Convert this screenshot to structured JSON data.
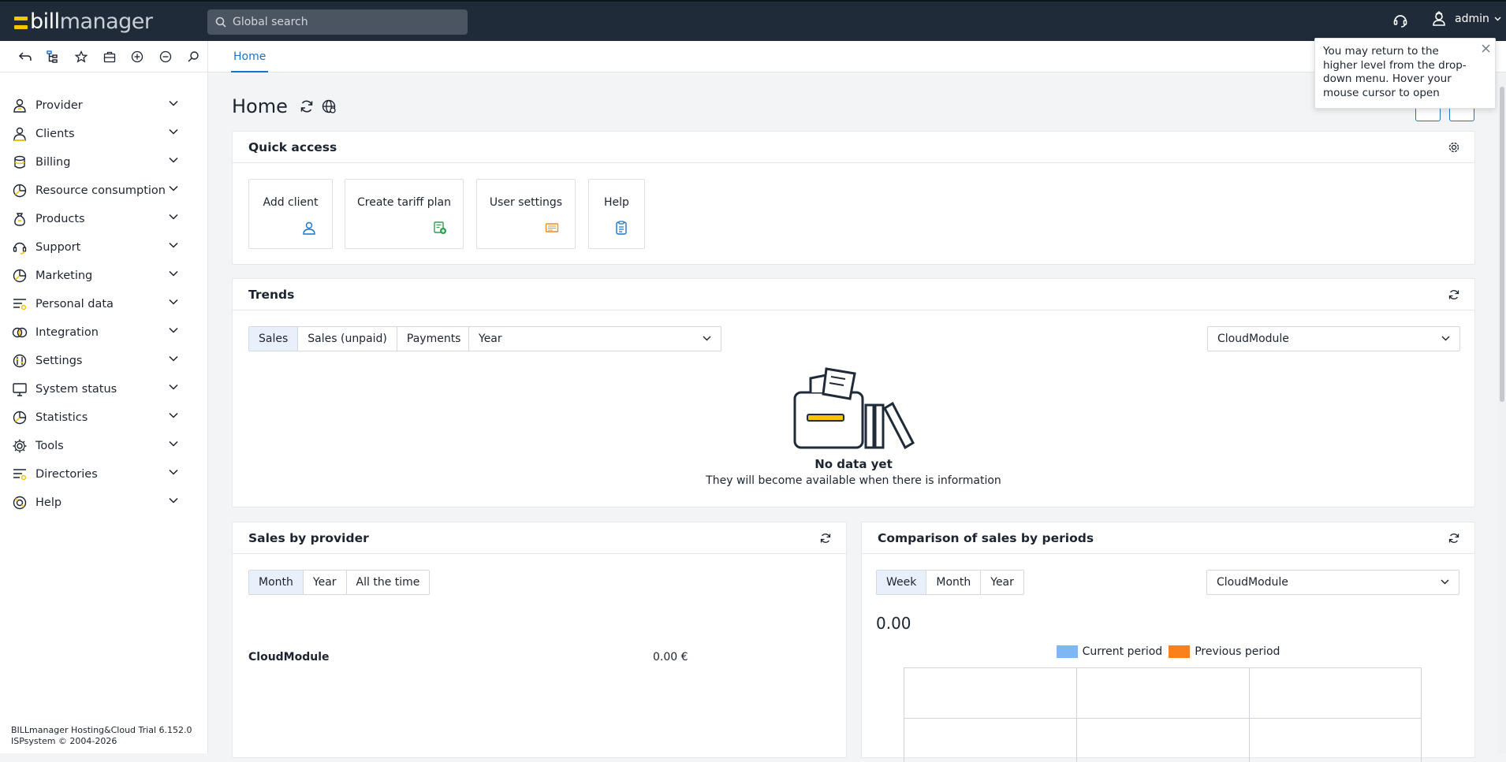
{
  "app": {
    "logo_text": "billmanager",
    "logo_bill": "bill",
    "logo_manager": "manager"
  },
  "topbar": {
    "search_placeholder": "Global search",
    "user_name": "admin"
  },
  "tabs": [
    {
      "label": "Home",
      "active": true
    }
  ],
  "sidebar": {
    "items": [
      {
        "label": "Provider",
        "icon": "provider-icon"
      },
      {
        "label": "Clients",
        "icon": "clients-icon"
      },
      {
        "label": "Billing",
        "icon": "billing-icon"
      },
      {
        "label": "Resource consumption",
        "icon": "pie-chart-icon"
      },
      {
        "label": "Products",
        "icon": "money-bag-icon"
      },
      {
        "label": "Support",
        "icon": "headset-icon"
      },
      {
        "label": "Marketing",
        "icon": "pie-chart-icon"
      },
      {
        "label": "Personal data",
        "icon": "list-icon"
      },
      {
        "label": "Integration",
        "icon": "rings-icon"
      },
      {
        "label": "Settings",
        "icon": "sliders-icon"
      },
      {
        "label": "System status",
        "icon": "monitor-icon"
      },
      {
        "label": "Statistics",
        "icon": "pie-chart-icon"
      },
      {
        "label": "Tools",
        "icon": "gear-icon"
      },
      {
        "label": "Directories",
        "icon": "list-icon"
      },
      {
        "label": "Help",
        "icon": "lifebuoy-icon"
      }
    ],
    "footer_line1": "BILLmanager Hosting&Cloud Trial 6.152.0",
    "footer_line2": "ISPsystem © 2004-2026"
  },
  "page": {
    "title": "Home"
  },
  "tooltip": {
    "text": "You may return to the higher level from the drop-down menu. Hover your mouse cursor to open"
  },
  "quick_access": {
    "title": "Quick access",
    "cards": [
      {
        "label": "Add client",
        "icon": "add-user-icon",
        "color": "#1a73c9"
      },
      {
        "label": "Create tariff plan",
        "icon": "tariff-plan-icon",
        "color": "#2aa44f"
      },
      {
        "label": "User settings",
        "icon": "user-settings-icon",
        "color": "#f08a24"
      },
      {
        "label": "Help",
        "icon": "help-doc-icon",
        "color": "#1a73c9"
      }
    ]
  },
  "trends": {
    "title": "Trends",
    "segments": [
      "Sales",
      "Sales (unpaid)",
      "Payments"
    ],
    "active_segment": "Sales",
    "period_select": "Year",
    "module_select": "CloudModule",
    "empty_title": "No data yet",
    "empty_subtitle": "They will become available when there is information"
  },
  "sales_by_provider": {
    "title": "Sales by provider",
    "segments": [
      "Month",
      "Year",
      "All the time"
    ],
    "active_segment": "Month",
    "rows": [
      {
        "name": "CloudModule",
        "value": "0.00 €"
      }
    ]
  },
  "comparison": {
    "title": "Comparison of sales by periods",
    "segments": [
      "Week",
      "Month",
      "Year"
    ],
    "active_segment": "Week",
    "module_select": "CloudModule",
    "total": "0.00",
    "legend": [
      {
        "label": "Current period",
        "color": "#7db7f5"
      },
      {
        "label": "Previous period",
        "color": "#f9801d"
      }
    ]
  },
  "colors": {
    "topbar": "#1f2b38",
    "accent": "#1a73c9",
    "logo_yellow": "#f5c500"
  }
}
